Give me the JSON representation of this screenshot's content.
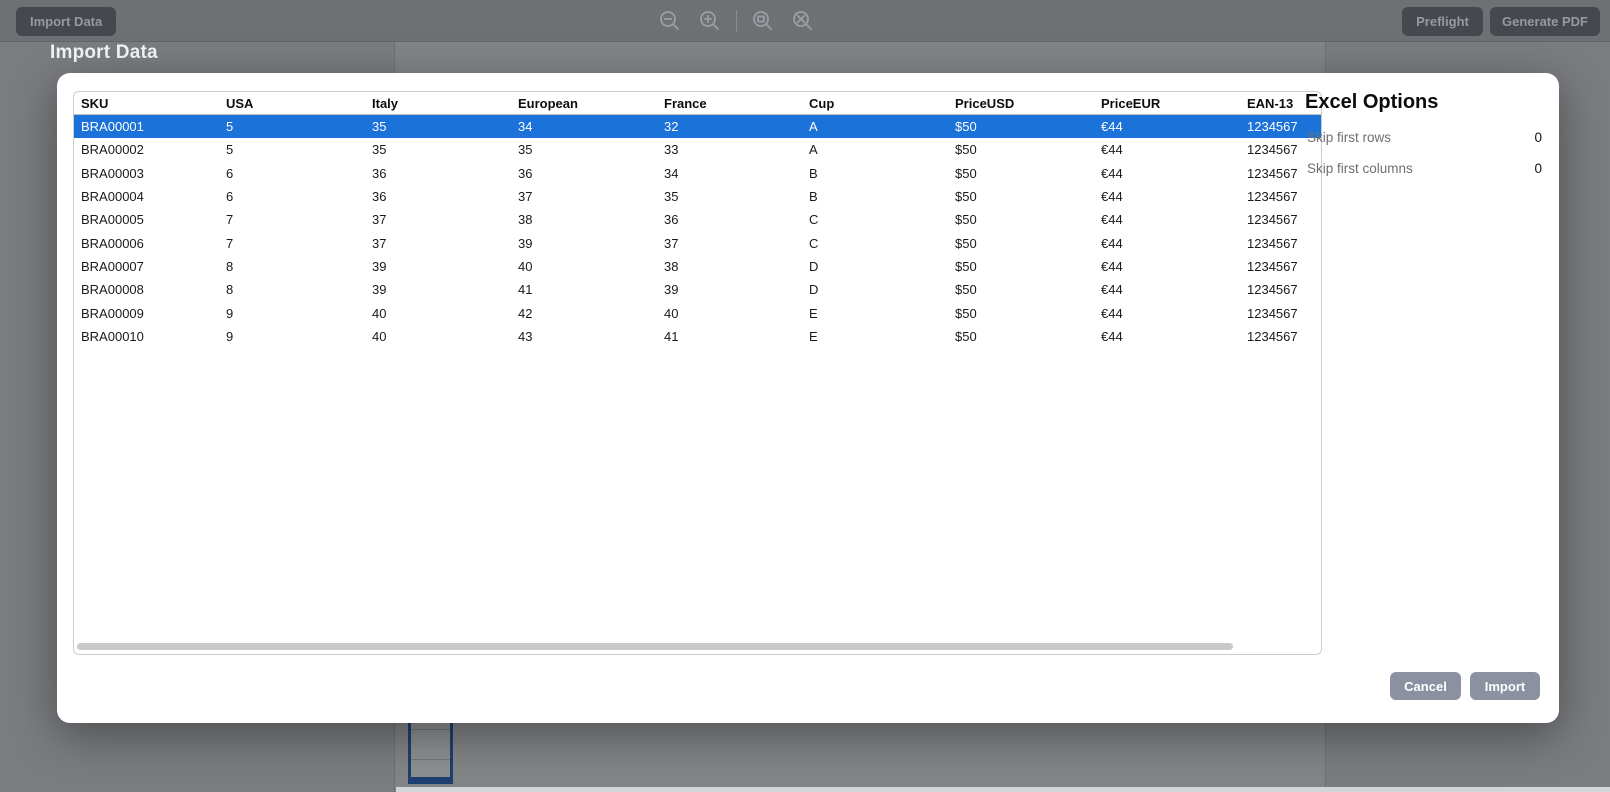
{
  "toolbar": {
    "import_data_label": "Import Data",
    "preflight_label": "Preflight",
    "generate_pdf_label": "Generate PDF",
    "icons": [
      "zoom-out",
      "zoom-in",
      "zoom-actual-size",
      "zoom-fit"
    ]
  },
  "modal": {
    "title": "Import Data",
    "table": {
      "columns": [
        "SKU",
        "USA",
        "Italy",
        "European",
        "France",
        "Cup",
        "PriceUSD",
        "PriceEUR",
        "EAN-13"
      ],
      "rows": [
        [
          "BRA00001",
          "5",
          "35",
          "34",
          "32",
          "A",
          "$50",
          "€44",
          "1234567"
        ],
        [
          "BRA00002",
          "5",
          "35",
          "35",
          "33",
          "A",
          "$50",
          "€44",
          "1234567"
        ],
        [
          "BRA00003",
          "6",
          "36",
          "36",
          "34",
          "B",
          "$50",
          "€44",
          "1234567"
        ],
        [
          "BRA00004",
          "6",
          "36",
          "37",
          "35",
          "B",
          "$50",
          "€44",
          "1234567"
        ],
        [
          "BRA00005",
          "7",
          "37",
          "38",
          "36",
          "C",
          "$50",
          "€44",
          "1234567"
        ],
        [
          "BRA00006",
          "7",
          "37",
          "39",
          "37",
          "C",
          "$50",
          "€44",
          "1234567"
        ],
        [
          "BRA00007",
          "8",
          "39",
          "40",
          "38",
          "D",
          "$50",
          "€44",
          "1234567"
        ],
        [
          "BRA00008",
          "8",
          "39",
          "41",
          "39",
          "D",
          "$50",
          "€44",
          "1234567"
        ],
        [
          "BRA00009",
          "9",
          "40",
          "42",
          "40",
          "E",
          "$50",
          "€44",
          "1234567"
        ],
        [
          "BRA00010",
          "9",
          "40",
          "43",
          "41",
          "E",
          "$50",
          "€44",
          "1234567"
        ]
      ],
      "selected_row_index": 0
    },
    "options": {
      "heading": "Excel Options",
      "fields": [
        {
          "label": "Skip first rows",
          "value": "0"
        },
        {
          "label": "Skip first columns",
          "value": "0"
        }
      ]
    },
    "cancel_label": "Cancel",
    "import_label": "Import"
  },
  "colors": {
    "selected_row": "#1b72d9",
    "modal_background": "#ffffff",
    "overlay_gray": "#818385",
    "toolbar_button": "#45484e",
    "footer_button": "#8b91a0"
  }
}
